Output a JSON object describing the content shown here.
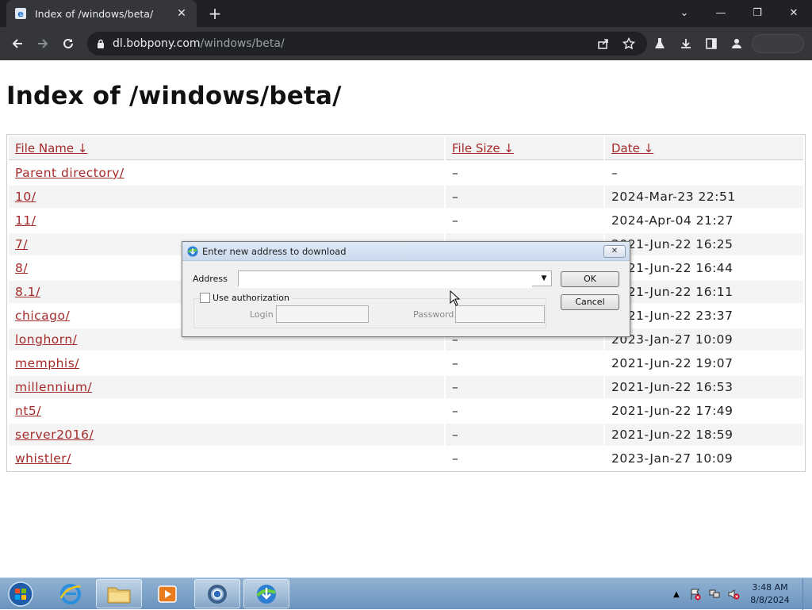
{
  "browser": {
    "tab_title": "Index of /windows/beta/",
    "tab_close": "✕",
    "new_tab": "+",
    "url_host": "dl.bobpony.com",
    "url_path": "/windows/beta/",
    "window_controls": [
      "⌄",
      "—",
      "❐",
      "✕"
    ]
  },
  "page": {
    "heading": "Index of /windows/beta/",
    "columns": {
      "name": "File Name  ↓",
      "size": "File Size  ↓",
      "date": "Date  ↓"
    },
    "rows": [
      {
        "name": "Parent directory/",
        "size": "–",
        "date": "–"
      },
      {
        "name": "10/",
        "size": "–",
        "date": "2024-Mar-23 22:51"
      },
      {
        "name": "11/",
        "size": "–",
        "date": "2024-Apr-04 21:27"
      },
      {
        "name": "7/",
        "size": "–",
        "date": "2021-Jun-22 16:25"
      },
      {
        "name": "8/",
        "size": "–",
        "date": "2021-Jun-22 16:44"
      },
      {
        "name": "8.1/",
        "size": "–",
        "date": "2021-Jun-22 16:11"
      },
      {
        "name": "chicago/",
        "size": "–",
        "date": "2021-Jun-22 23:37"
      },
      {
        "name": "longhorn/",
        "size": "–",
        "date": "2023-Jan-27 10:09"
      },
      {
        "name": "memphis/",
        "size": "–",
        "date": "2021-Jun-22 19:07"
      },
      {
        "name": "millennium/",
        "size": "–",
        "date": "2021-Jun-22 16:53"
      },
      {
        "name": "nt5/",
        "size": "–",
        "date": "2021-Jun-22 17:49"
      },
      {
        "name": "server2016/",
        "size": "–",
        "date": "2021-Jun-22 18:59"
      },
      {
        "name": "whistler/",
        "size": "–",
        "date": "2023-Jan-27 10:09"
      }
    ]
  },
  "dialog": {
    "title": "Enter new address to download",
    "close": "✕",
    "address_label": "Address",
    "address_value": "",
    "ok": "OK",
    "cancel": "Cancel",
    "use_auth": "Use authorization",
    "login_label": "Login",
    "password_label": "Password"
  },
  "taskbar": {
    "time": "3:48 AM",
    "date": "8/8/2024",
    "tray_chevron": "▲"
  },
  "colors": {
    "link": "#a52a2a",
    "chrome_dark": "#202124",
    "chrome_toolbar": "#35363a"
  },
  "icons": [
    "favicon-ie-icon",
    "back-icon",
    "forward-icon",
    "reload-icon",
    "lock-icon",
    "share-icon",
    "star-icon",
    "labs-icon",
    "download-icon",
    "sidepanel-icon",
    "profile-icon",
    "idm-icon",
    "start-icon",
    "ie-icon",
    "folder-icon",
    "media-player-icon",
    "chrome-icon",
    "flag-icon",
    "network-icon",
    "volume-muted-icon",
    "mouse-cursor-icon"
  ]
}
